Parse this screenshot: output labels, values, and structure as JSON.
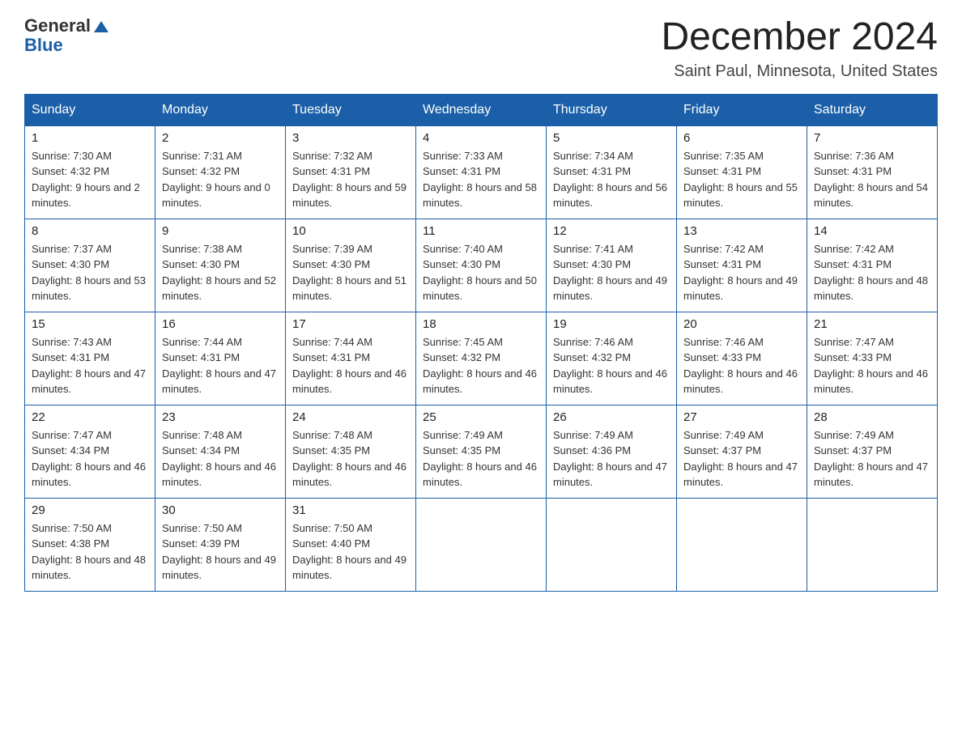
{
  "header": {
    "logo_general": "General",
    "logo_blue": "Blue",
    "month_title": "December 2024",
    "location": "Saint Paul, Minnesota, United States"
  },
  "days_of_week": [
    "Sunday",
    "Monday",
    "Tuesday",
    "Wednesday",
    "Thursday",
    "Friday",
    "Saturday"
  ],
  "weeks": [
    [
      {
        "day": "1",
        "sunrise": "7:30 AM",
        "sunset": "4:32 PM",
        "daylight": "9 hours and 2 minutes."
      },
      {
        "day": "2",
        "sunrise": "7:31 AM",
        "sunset": "4:32 PM",
        "daylight": "9 hours and 0 minutes."
      },
      {
        "day": "3",
        "sunrise": "7:32 AM",
        "sunset": "4:31 PM",
        "daylight": "8 hours and 59 minutes."
      },
      {
        "day": "4",
        "sunrise": "7:33 AM",
        "sunset": "4:31 PM",
        "daylight": "8 hours and 58 minutes."
      },
      {
        "day": "5",
        "sunrise": "7:34 AM",
        "sunset": "4:31 PM",
        "daylight": "8 hours and 56 minutes."
      },
      {
        "day": "6",
        "sunrise": "7:35 AM",
        "sunset": "4:31 PM",
        "daylight": "8 hours and 55 minutes."
      },
      {
        "day": "7",
        "sunrise": "7:36 AM",
        "sunset": "4:31 PM",
        "daylight": "8 hours and 54 minutes."
      }
    ],
    [
      {
        "day": "8",
        "sunrise": "7:37 AM",
        "sunset": "4:30 PM",
        "daylight": "8 hours and 53 minutes."
      },
      {
        "day": "9",
        "sunrise": "7:38 AM",
        "sunset": "4:30 PM",
        "daylight": "8 hours and 52 minutes."
      },
      {
        "day": "10",
        "sunrise": "7:39 AM",
        "sunset": "4:30 PM",
        "daylight": "8 hours and 51 minutes."
      },
      {
        "day": "11",
        "sunrise": "7:40 AM",
        "sunset": "4:30 PM",
        "daylight": "8 hours and 50 minutes."
      },
      {
        "day": "12",
        "sunrise": "7:41 AM",
        "sunset": "4:30 PM",
        "daylight": "8 hours and 49 minutes."
      },
      {
        "day": "13",
        "sunrise": "7:42 AM",
        "sunset": "4:31 PM",
        "daylight": "8 hours and 49 minutes."
      },
      {
        "day": "14",
        "sunrise": "7:42 AM",
        "sunset": "4:31 PM",
        "daylight": "8 hours and 48 minutes."
      }
    ],
    [
      {
        "day": "15",
        "sunrise": "7:43 AM",
        "sunset": "4:31 PM",
        "daylight": "8 hours and 47 minutes."
      },
      {
        "day": "16",
        "sunrise": "7:44 AM",
        "sunset": "4:31 PM",
        "daylight": "8 hours and 47 minutes."
      },
      {
        "day": "17",
        "sunrise": "7:44 AM",
        "sunset": "4:31 PM",
        "daylight": "8 hours and 46 minutes."
      },
      {
        "day": "18",
        "sunrise": "7:45 AM",
        "sunset": "4:32 PM",
        "daylight": "8 hours and 46 minutes."
      },
      {
        "day": "19",
        "sunrise": "7:46 AM",
        "sunset": "4:32 PM",
        "daylight": "8 hours and 46 minutes."
      },
      {
        "day": "20",
        "sunrise": "7:46 AM",
        "sunset": "4:33 PM",
        "daylight": "8 hours and 46 minutes."
      },
      {
        "day": "21",
        "sunrise": "7:47 AM",
        "sunset": "4:33 PM",
        "daylight": "8 hours and 46 minutes."
      }
    ],
    [
      {
        "day": "22",
        "sunrise": "7:47 AM",
        "sunset": "4:34 PM",
        "daylight": "8 hours and 46 minutes."
      },
      {
        "day": "23",
        "sunrise": "7:48 AM",
        "sunset": "4:34 PM",
        "daylight": "8 hours and 46 minutes."
      },
      {
        "day": "24",
        "sunrise": "7:48 AM",
        "sunset": "4:35 PM",
        "daylight": "8 hours and 46 minutes."
      },
      {
        "day": "25",
        "sunrise": "7:49 AM",
        "sunset": "4:35 PM",
        "daylight": "8 hours and 46 minutes."
      },
      {
        "day": "26",
        "sunrise": "7:49 AM",
        "sunset": "4:36 PM",
        "daylight": "8 hours and 47 minutes."
      },
      {
        "day": "27",
        "sunrise": "7:49 AM",
        "sunset": "4:37 PM",
        "daylight": "8 hours and 47 minutes."
      },
      {
        "day": "28",
        "sunrise": "7:49 AM",
        "sunset": "4:37 PM",
        "daylight": "8 hours and 47 minutes."
      }
    ],
    [
      {
        "day": "29",
        "sunrise": "7:50 AM",
        "sunset": "4:38 PM",
        "daylight": "8 hours and 48 minutes."
      },
      {
        "day": "30",
        "sunrise": "7:50 AM",
        "sunset": "4:39 PM",
        "daylight": "8 hours and 49 minutes."
      },
      {
        "day": "31",
        "sunrise": "7:50 AM",
        "sunset": "4:40 PM",
        "daylight": "8 hours and 49 minutes."
      },
      null,
      null,
      null,
      null
    ]
  ]
}
